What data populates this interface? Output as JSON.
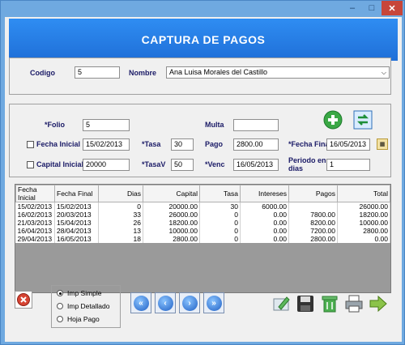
{
  "window": {
    "min_glyph": "–",
    "max_glyph": "□",
    "close_glyph": "✕"
  },
  "header": {
    "title": "CAPTURA DE PAGOS"
  },
  "client": {
    "codigo_label": "Codigo",
    "codigo_value": "5",
    "nombre_label": "Nombre",
    "nombre_value": "Ana Luisa Morales del Castillo"
  },
  "form": {
    "folio_label": "*Folio",
    "folio_value": "5",
    "multa_label": "Multa",
    "multa_value": "",
    "fecha_inicial_label": "Fecha Inicial",
    "fecha_inicial_value": "15/02/2013",
    "tasa_label": "*Tasa",
    "tasa_value": "30",
    "pago_label": "Pago",
    "pago_value": "2800.00",
    "fecha_final_label": "*Fecha Final",
    "fecha_final_value": "16/05/2013",
    "capital_inicial_label": "Capital Inicial",
    "capital_inicial_value": "20000",
    "tasav_label": "*TasaV",
    "tasav_value": "50",
    "venc_label": "*Venc",
    "venc_value": "16/05/2013",
    "periodo_label_1": "Periodo en",
    "periodo_label_2": "dias",
    "periodo_value": "1"
  },
  "table": {
    "headers": [
      "Fecha Inicial",
      "Fecha Final",
      "Dias",
      "Capital",
      "Tasa",
      "Intereses",
      "Pagos",
      "Total"
    ],
    "rows": [
      [
        "15/02/2013",
        "15/02/2013",
        "0",
        "20000.00",
        "30",
        "6000.00",
        "",
        "26000.00"
      ],
      [
        "16/02/2013",
        "20/03/2013",
        "33",
        "26000.00",
        "0",
        "0.00",
        "7800.00",
        "18200.00"
      ],
      [
        "21/03/2013",
        "15/04/2013",
        "26",
        "18200.00",
        "0",
        "0.00",
        "8200.00",
        "10000.00"
      ],
      [
        "16/04/2013",
        "28/04/2013",
        "13",
        "10000.00",
        "0",
        "0.00",
        "7200.00",
        "2800.00"
      ],
      [
        "29/04/2013",
        "16/05/2013",
        "18",
        "2800.00",
        "0",
        "0.00",
        "2800.00",
        "0.00"
      ]
    ]
  },
  "print_options": {
    "options": [
      "Imp Simple",
      "Imp Detallado",
      "Hoja Pago"
    ],
    "selected": "Imp Simple"
  },
  "colors": {
    "header_bg": "#2178e4",
    "window_frame": "#6fa9e0",
    "close_red": "#c7463a",
    "add_green": "#3aa845"
  }
}
